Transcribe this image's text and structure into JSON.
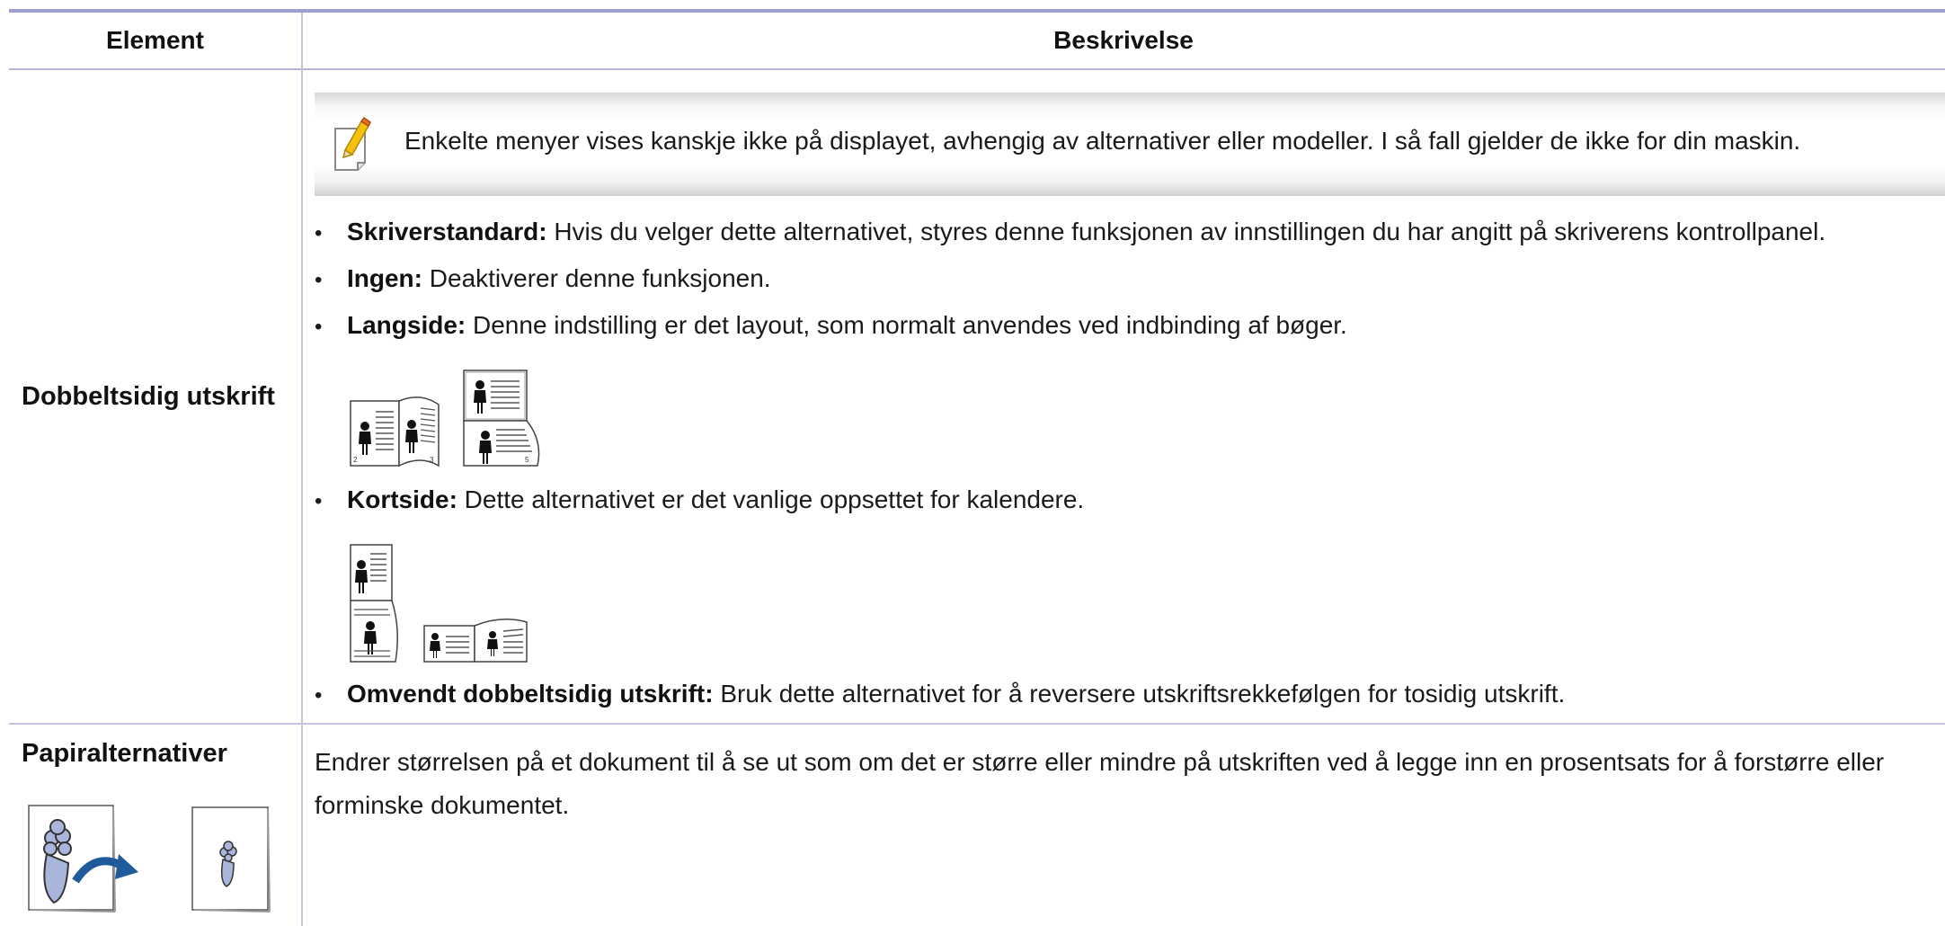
{
  "header": {
    "element": "Element",
    "beskrivelse": "Beskrivelse"
  },
  "rows": [
    {
      "element": "Dobbeltsidig utskrift",
      "note": "Enkelte menyer vises kanskje ikke på displayet, avhengig av alternativer eller modeller. I så fall gjelder de ikke for din maskin.",
      "bullets": [
        {
          "term": "Skriverstandard:",
          "text": " Hvis du velger dette alternativet, styres denne funksjonen av innstillingen du har angitt på skriverens kontrollpanel."
        },
        {
          "term": "Ingen:",
          "text": " Deaktiverer denne funksjonen."
        },
        {
          "term": "Langside:",
          "text": " Denne indstilling er det layout, som normalt anvendes ved indbinding af bøger."
        },
        {
          "term": "Kortside:",
          "text": " Dette alternativet er det vanlige oppsettet for kalendere."
        },
        {
          "term": "Omvendt dobbeltsidig utskrift:",
          "text": " Bruk dette alternativet for å reversere utskriftsrekkefølgen for tosidig utskrift."
        }
      ],
      "page_numbers": {
        "left": "2",
        "right": "3",
        "odd": "5"
      }
    },
    {
      "element": "Papiralternativer",
      "description": "Endrer størrelsen på et dokument til å se ut som om det er større eller mindre på utskriften ved å legge inn en prosentsats for å forstørre eller forminske dokumentet."
    }
  ],
  "colors": {
    "accent_rule": "#9e9fd0",
    "grid": "#c3c4de",
    "arrow": "#1f5b9a",
    "figure": "#aab5dc"
  },
  "icons": [
    "note-pencil-icon",
    "long-edge-binding-icon",
    "short-edge-binding-icon",
    "scaling-arrow-icon",
    "vase-figure-icon"
  ]
}
